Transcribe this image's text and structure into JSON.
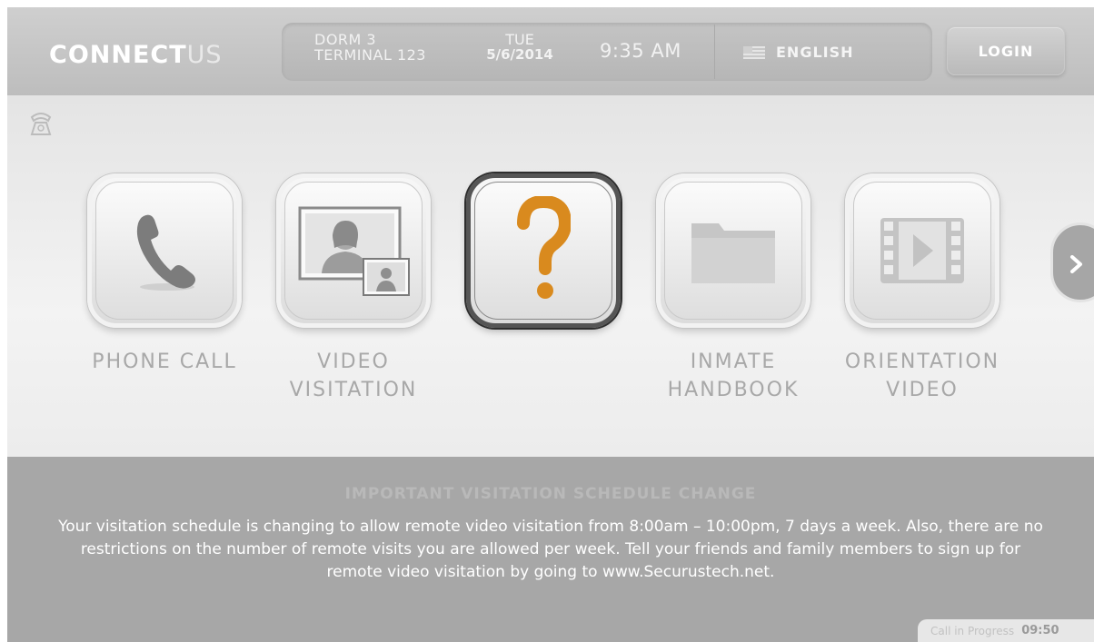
{
  "header": {
    "logo": {
      "part1": "CONNECT",
      "part2": "US"
    },
    "location": {
      "line1": "DORM 3",
      "line2": "TERMINAL 123"
    },
    "date": {
      "day": "TUE",
      "date": "5/6/2014"
    },
    "time": "9:35 AM",
    "language": {
      "label": "ENGLISH",
      "icon": "us-flag-icon"
    },
    "login_label": "LOGIN"
  },
  "main": {
    "status_icon": "phone-handset-icon",
    "tiles": [
      {
        "line1": "PHONE CALL",
        "line2": "",
        "icon": "phone-icon"
      },
      {
        "line1": "VIDEO",
        "line2": "VISITATION",
        "icon": "video-visitation-icon"
      },
      {
        "line1": "",
        "line2": "",
        "icon": "question-mark-icon",
        "selected": true,
        "icon_color": "#d98a1e"
      },
      {
        "line1": "INMATE",
        "line2": "HANDBOOK",
        "icon": "folder-icon"
      },
      {
        "line1": "ORIENTATION",
        "line2": "VIDEO",
        "icon": "film-play-icon"
      }
    ],
    "next_icon": "chevron-right-icon"
  },
  "announcement": {
    "title": "IMPORTANT VISITATION SCHEDULE CHANGE",
    "body": "Your visitation schedule is changing to allow remote video visitation from 8:00am – 10:00pm, 7 days a week. Also, there are no restrictions on the number of remote visits you are allowed per week. Tell your friends and family members to sign up for remote video visitation by going to www.Securustech.net."
  },
  "call_status": {
    "label": "Call in Progress",
    "timer": "09:50"
  }
}
